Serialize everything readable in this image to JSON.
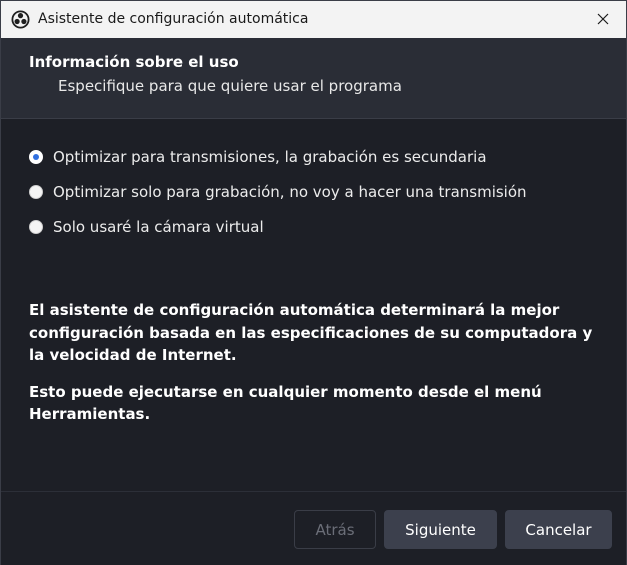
{
  "window": {
    "title": "Asistente de configuración automática",
    "app_icon": "obs-logo-icon",
    "close_icon": "close-icon"
  },
  "header": {
    "title": "Información sobre el uso",
    "subtitle": "Especifique para que quiere usar el programa"
  },
  "options": [
    {
      "label": "Optimizar para transmisiones, la grabación es secundaria",
      "checked": true
    },
    {
      "label": "Optimizar solo para grabación, no voy a hacer una transmisión",
      "checked": false
    },
    {
      "label": "Solo usaré la cámara virtual",
      "checked": false
    }
  ],
  "info": {
    "paragraph1": "El asistente de configuración automática determinará la mejor configuración basada en las especificaciones de su computadora y la velocidad de Internet.",
    "paragraph2": "Esto puede ejecutarse en cualquier momento desde el menú Herramientas."
  },
  "footer": {
    "back_label": "Atrás",
    "back_enabled": false,
    "next_label": "Siguiente",
    "cancel_label": "Cancelar"
  },
  "colors": {
    "background": "#1d1f26",
    "header_background": "#2a2d36",
    "titlebar_background": "#f3f3f3",
    "radio_accent": "#2f6fe0",
    "button_background": "#3c404d",
    "disabled_text": "#6b6e78"
  }
}
